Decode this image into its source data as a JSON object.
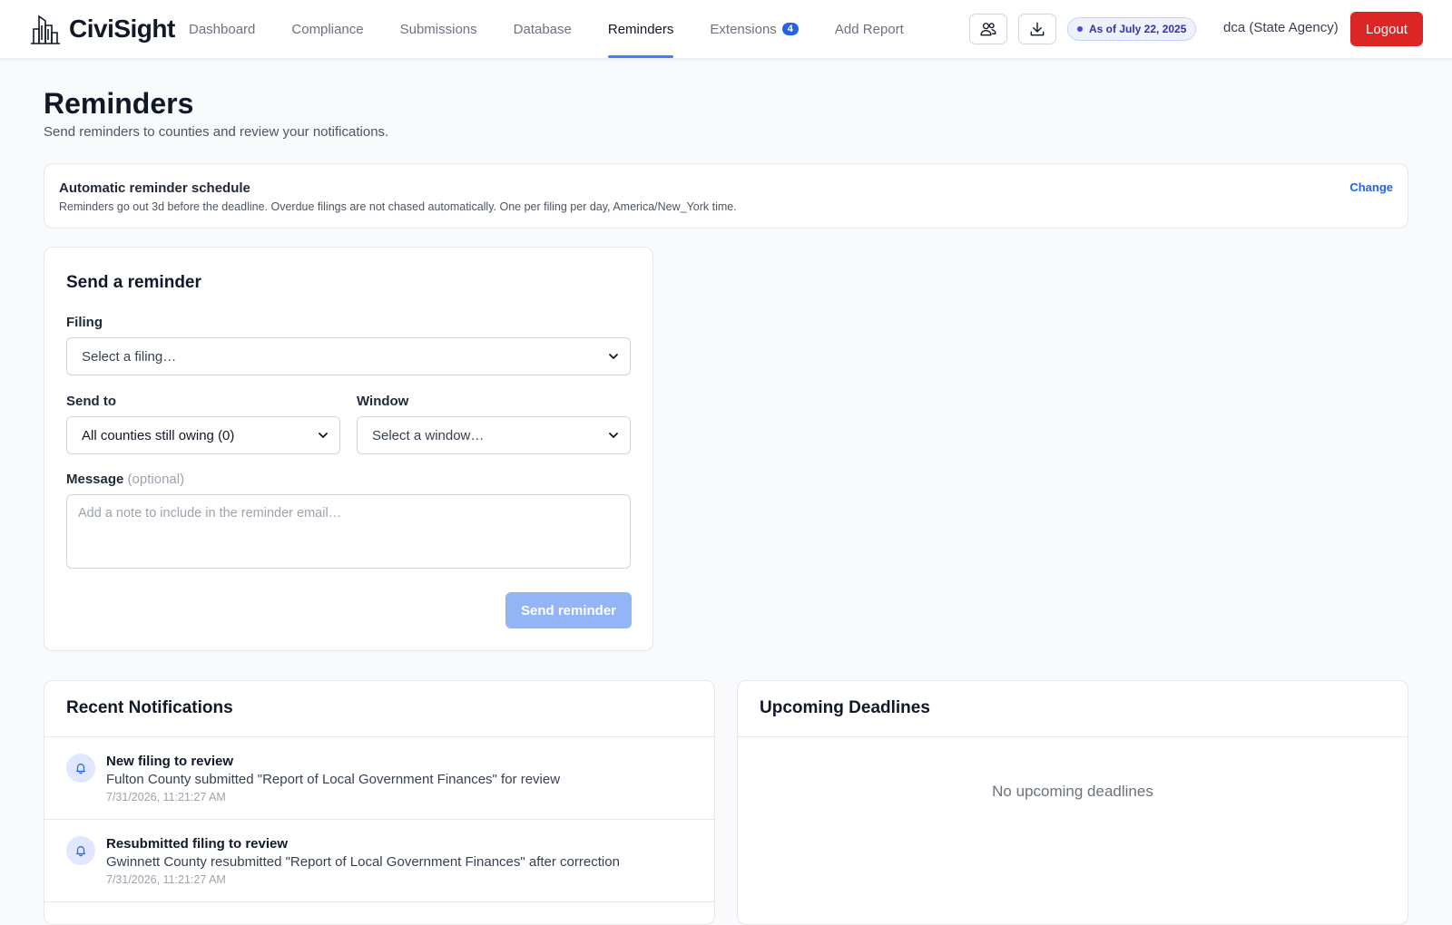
{
  "app": {
    "name": "CiviSight"
  },
  "nav": {
    "items": [
      {
        "label": "Dashboard"
      },
      {
        "label": "Compliance"
      },
      {
        "label": "Submissions"
      },
      {
        "label": "Database"
      },
      {
        "label": "Reminders",
        "active": true
      },
      {
        "label": "Extensions",
        "badge": "4"
      },
      {
        "label": "Add Report"
      }
    ]
  },
  "header": {
    "date_pill": "As of July 22, 2025",
    "user": "dca (State Agency)",
    "logout_label": "Logout",
    "icons": [
      "users-icon",
      "download-icon"
    ]
  },
  "page": {
    "title": "Reminders",
    "subtitle": "Send reminders to counties and review your notifications."
  },
  "schedule": {
    "title": "Automatic reminder schedule",
    "description": "Reminders go out 3d before the deadline. Overdue filings are not chased automatically. One per filing per day, America/New_York time.",
    "change_label": "Change"
  },
  "send_form": {
    "title": "Send a reminder",
    "filing_label": "Filing",
    "filing_value": "Select a filing…",
    "send_to_label": "Send to",
    "send_to_value": "All counties still owing (0)",
    "window_label": "Window",
    "window_value": "Select a window…",
    "message_label": "Message",
    "message_optional": "(optional)",
    "message_placeholder": "Add a note to include in the reminder email…",
    "submit_label": "Send reminder"
  },
  "notifications": {
    "title": "Recent Notifications",
    "items": [
      {
        "title": "New filing to review",
        "message": "Fulton County submitted \"Report of Local Government Finances\" for review",
        "date": "7/31/2026, 11:21:27 AM"
      },
      {
        "title": "Resubmitted filing to review",
        "message": "Gwinnett County resubmitted \"Report of Local Government Finances\" after correction",
        "date": "7/31/2026, 11:21:27 AM"
      }
    ]
  },
  "deadlines": {
    "title": "Upcoming Deadlines",
    "empty_text": "No upcoming deadlines"
  },
  "colors": {
    "accent": "#3b82f6",
    "logout": "#dc2626",
    "badge": "#2563eb",
    "send_button_disabled": "#93b4f6"
  }
}
